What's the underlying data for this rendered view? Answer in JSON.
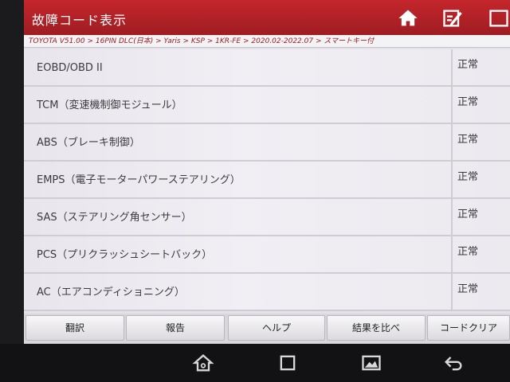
{
  "header": {
    "title": "故障コード表示",
    "home_icon": "home-icon",
    "report_icon": "edit-report-icon"
  },
  "breadcrumb": "TOYOTA V51.00 > 16PIN DLC(日本) > Yaris > KSP > 1KR-FE > 2020.02-2022.07 > スマートキー付",
  "systems": [
    {
      "name": "EOBD/OBD II",
      "status": "正常"
    },
    {
      "name": "TCM（変速機制御モジュール）",
      "status": "正常"
    },
    {
      "name": "ABS（ブレーキ制御）",
      "status": "正常"
    },
    {
      "name": "EMPS（電子モーターパワーステアリング）",
      "status": "正常"
    },
    {
      "name": "SAS（ステアリング角センサー）",
      "status": "正常"
    },
    {
      "name": "PCS（プリクラッシュシートバック）",
      "status": "正常"
    },
    {
      "name": "AC（エアコンディショニング）",
      "status": "正常"
    }
  ],
  "buttons": {
    "translate": "翻訳",
    "report": "報告",
    "help": "ヘルプ",
    "compare": "結果を比べ",
    "clear": "コードクリア"
  },
  "nav_icons": [
    "back-icon",
    "home-icon",
    "recents-icon",
    "screenshot-icon"
  ],
  "colors": {
    "title_bar": "#b32227",
    "breadcrumb_text": "#9a1d22",
    "list_bg": "#ece9ef"
  }
}
